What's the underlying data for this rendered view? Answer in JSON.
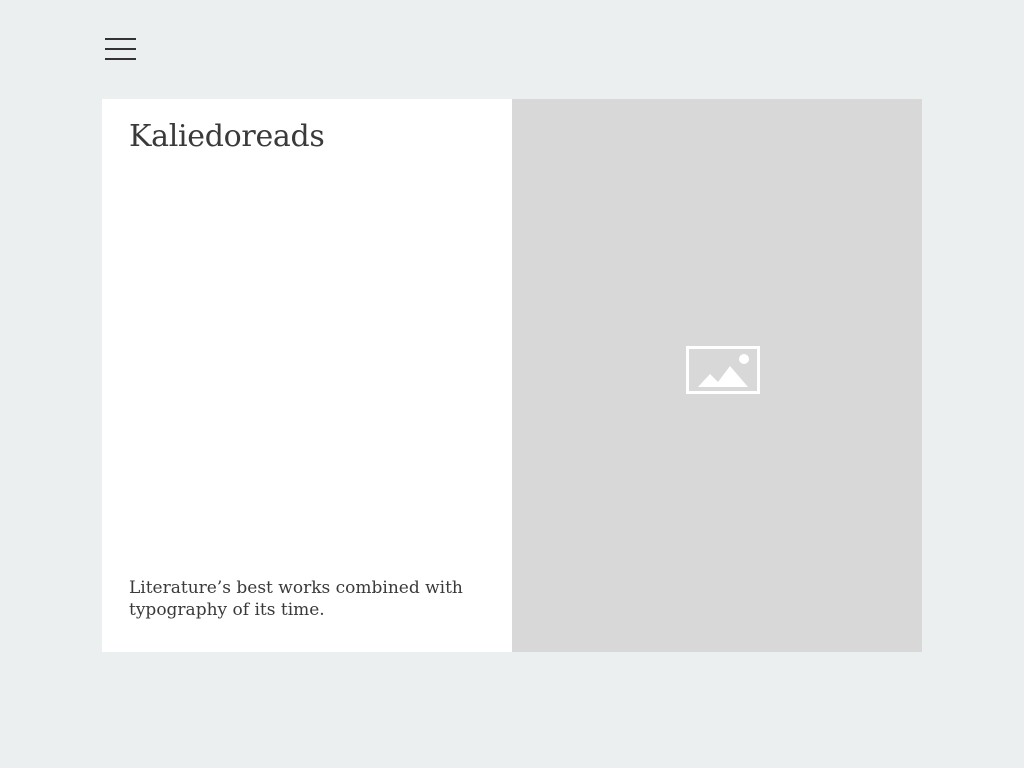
{
  "header": {
    "menu_icon": "hamburger-menu-icon"
  },
  "card": {
    "title": "Kaliedoreads",
    "description": "Literature’s best works combined with typography of its time.",
    "image_icon": "image-placeholder-icon"
  },
  "colors": {
    "page_background": "#ebeff0",
    "card_background": "#ffffff",
    "image_background": "#d8d8d8",
    "text": "#3a3a3a"
  }
}
